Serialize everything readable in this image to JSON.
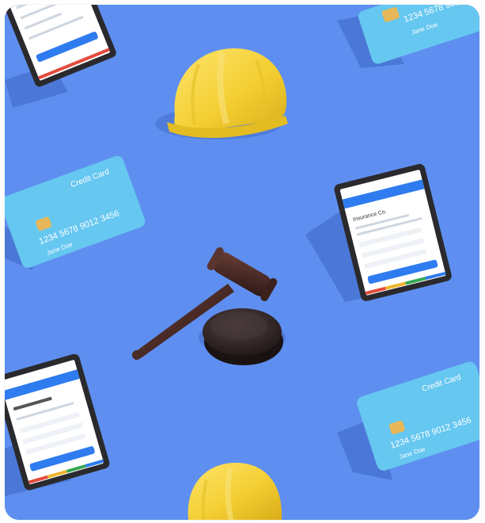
{
  "credit_card": {
    "title": "Credit Card",
    "number": "1234 5678 9012 3456",
    "holder": "Jane Doe"
  },
  "tablet": {
    "company": "Insurance Co."
  },
  "colors": {
    "background": "#5e8ff0",
    "card": "#66c7f0",
    "helmet": "#f5d03a",
    "gavel": "#3d2320",
    "tablet_accent": "#2f7bf0"
  }
}
